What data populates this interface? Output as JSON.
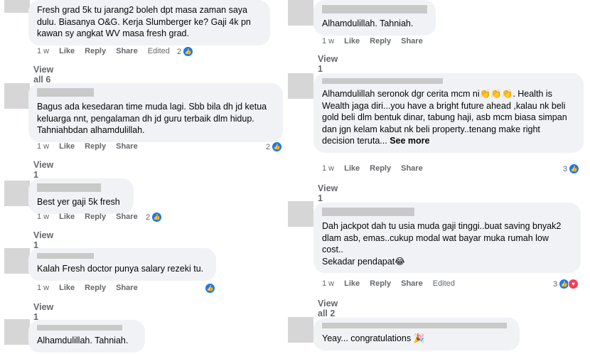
{
  "icons": {
    "like": "thumbs-up-icon",
    "love": "heart-icon"
  },
  "left": [
    {
      "text": "Fresh grad 5k tu jarang2 boleh dpt masa zaman saya dulu. Biasanya O&G. Kerja Slumberger ke? Gaji 4k pn kawan sy angkat WV masa fresh grad.",
      "time": "1 w",
      "like": "Like",
      "reply": "Reply",
      "share": "Share",
      "edited": "Edited",
      "reactions": "2",
      "replies": "View all 6 replies"
    },
    {
      "text": "Bagus ada kesedaran time muda lagi. Sbb bila dh jd ketua keluarga nnt, pengalaman dh jd guru terbaik dlm hidup. Tahniahbdan alhamdulillah.",
      "time": "1 w",
      "like": "Like",
      "reply": "Reply",
      "share": "Share",
      "reactions": "2",
      "replies": "View 1 reply"
    },
    {
      "text": "Best yer gaji 5k fresh",
      "time": "1 w",
      "like": "Like",
      "reply": "Reply",
      "share": "Share",
      "reactions": "2",
      "replies": "View 1 reply"
    },
    {
      "text": "Kalah Fresh doctor punya salary rezeki tu.",
      "time": "1 w",
      "like": "Like",
      "reply": "Reply",
      "share": "Share",
      "reactions": "",
      "replies": "View 1 reply"
    },
    {
      "text": "Alhamdulillah. Tahniah."
    }
  ],
  "right": [
    {
      "text": "Alhamdulillah. Tahniah.",
      "time": "1 w",
      "like": "Like",
      "reply": "Reply",
      "share": "Share",
      "replies": "View 1 reply"
    },
    {
      "text": "Alhamdulillah seronok dgr cerita mcm ni👏👏👏. Health is Wealth jaga diri...you have a bright future ahead ,kalau nk beli gold beli dlm bentuk dinar, tabung haji, asb mcm biasa simpan dan jgn kelam kabut nk beli property..tenang make right decision teruta...",
      "see_more": "See more",
      "time": "1 w",
      "like": "Like",
      "reply": "Reply",
      "share": "Share",
      "reactions": "3",
      "replies": "View 1 reply"
    },
    {
      "text": "Dah jackpot dah tu usia muda gaji tinggi..buat saving bnyak2 dlam asb, emas..cukup modal wat bayar muka rumah low cost..\nSekadar pendapat😂",
      "time": "1 w",
      "like": "Like",
      "reply": "Reply",
      "share": "Share",
      "edited": "Edited",
      "reactions": "3",
      "replies": "View all 2 replies"
    },
    {
      "text": "Yeay... congratulations 🎉"
    }
  ]
}
